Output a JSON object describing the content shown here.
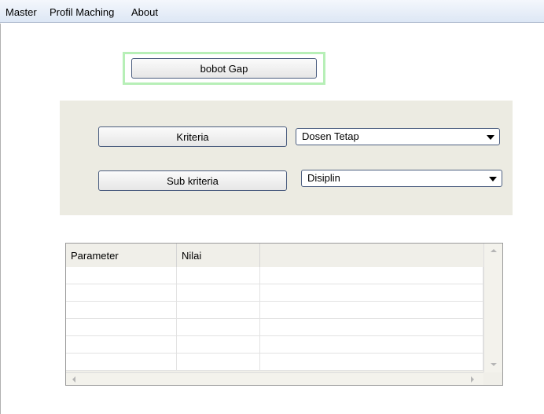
{
  "menu": {
    "items": [
      {
        "label": "Master"
      },
      {
        "label": "Profil Maching"
      },
      {
        "label": "About"
      }
    ]
  },
  "buttons": {
    "bobot_gap": "bobot Gap",
    "kriteria": "Kriteria",
    "sub_kriteria": "Sub kriteria"
  },
  "combos": {
    "kriteria_selected": "Dosen Tetap",
    "sub_kriteria_selected": "Disiplin"
  },
  "grid": {
    "columns": [
      "Parameter",
      "Nilai"
    ],
    "rows": [
      [
        "",
        ""
      ],
      [
        "",
        ""
      ],
      [
        "",
        ""
      ],
      [
        "",
        ""
      ],
      [
        "",
        ""
      ],
      [
        "",
        ""
      ]
    ]
  },
  "colors": {
    "menubar": "#dde7f5",
    "panel": "#ecebe2",
    "focus_ring": "#b7efb7",
    "button_border": "#4c5e80"
  },
  "icons": {
    "combo_arrow": "chevron-down-icon",
    "scroll_up": "scroll-up-arrow-icon",
    "scroll_down": "scroll-down-arrow-icon",
    "scroll_left": "scroll-left-arrow-icon",
    "scroll_right": "scroll-right-arrow-icon"
  }
}
